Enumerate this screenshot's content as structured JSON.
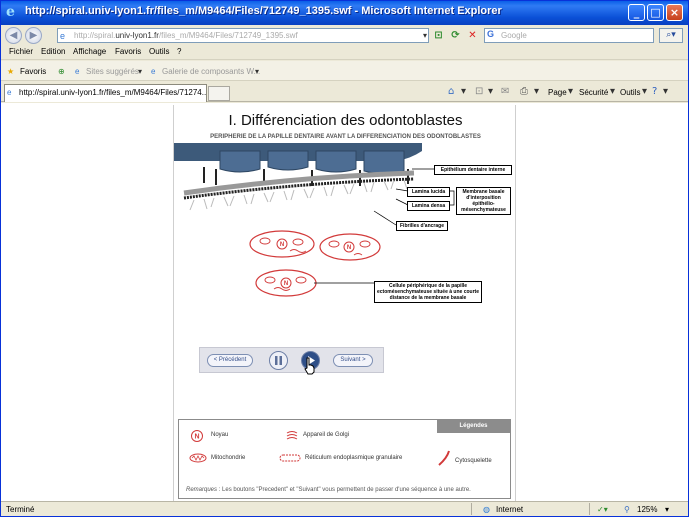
{
  "window": {
    "title": "http://spiral.univ-lyon1.fr/files_m/M9464/Files/712749_1395.swf - Microsoft Internet Explorer"
  },
  "address_bar": {
    "url_prefix": "http://spiral.",
    "url_domain": "univ-lyon1.fr",
    "url_rest": "/files_m/M9464/Files/712749_1395.swf",
    "search_placeholder": "Google"
  },
  "menu": {
    "items": [
      "Fichier",
      "Edition",
      "Affichage",
      "Favoris",
      "Outils",
      "?"
    ]
  },
  "favorites_bar": {
    "favorites_label": "Favoris",
    "suggested_sites": "Sites suggérés",
    "gallery": "Galerie de composants W..."
  },
  "tab_row": {
    "tab_title": "http://spiral.univ-lyon1.fr/files_m/M9464/Files/71274...",
    "page_label": "Page",
    "security_label": "Sécurité",
    "tools_label": "Outils"
  },
  "slide": {
    "title": "I. Différenciation des odontoblastes",
    "subtitle": "PERIPHERIE DE LA PAPILLE DENTAIRE AVANT LA DIFFERENCIATION DES ODONTOBLASTES",
    "labels": {
      "epithelium": "Epithélium dentaire interne",
      "lamina_lucida": "Lamina lucida",
      "lamina_densa": "Lamina densa",
      "membrane": "Membrane basale d'interposition épithélio-mésenchymateuse",
      "fibrilles": "Fibrilles d'ancrage",
      "cellule": "Cellule périphérique de la papille ectomésenchymateuse située à une courte distance de la membrane basale"
    },
    "controls": {
      "prev": "< Précédent",
      "next": "Suivant >"
    },
    "legend": {
      "title": "Légendes",
      "noyau": "Noyau",
      "golgi": "Appareil de Golgi",
      "mito": "Mitochondrie",
      "reticulum": "Réticulum endoplasmique granulaire",
      "cyto": "Cytosquelette",
      "remark_label": "Remarques",
      "remark": " : Les boutons \"Precedent\" et \"Suivant\" vous permettent de passer d'une séquence à une autre."
    }
  },
  "status_bar": {
    "status": "Terminé",
    "zone": "Internet",
    "zoom": "125%"
  },
  "colors": {
    "epithelium_blue": "#3d5a7a",
    "cell_red": "#d23a3a",
    "xp_blue": "#0a4fd6"
  }
}
